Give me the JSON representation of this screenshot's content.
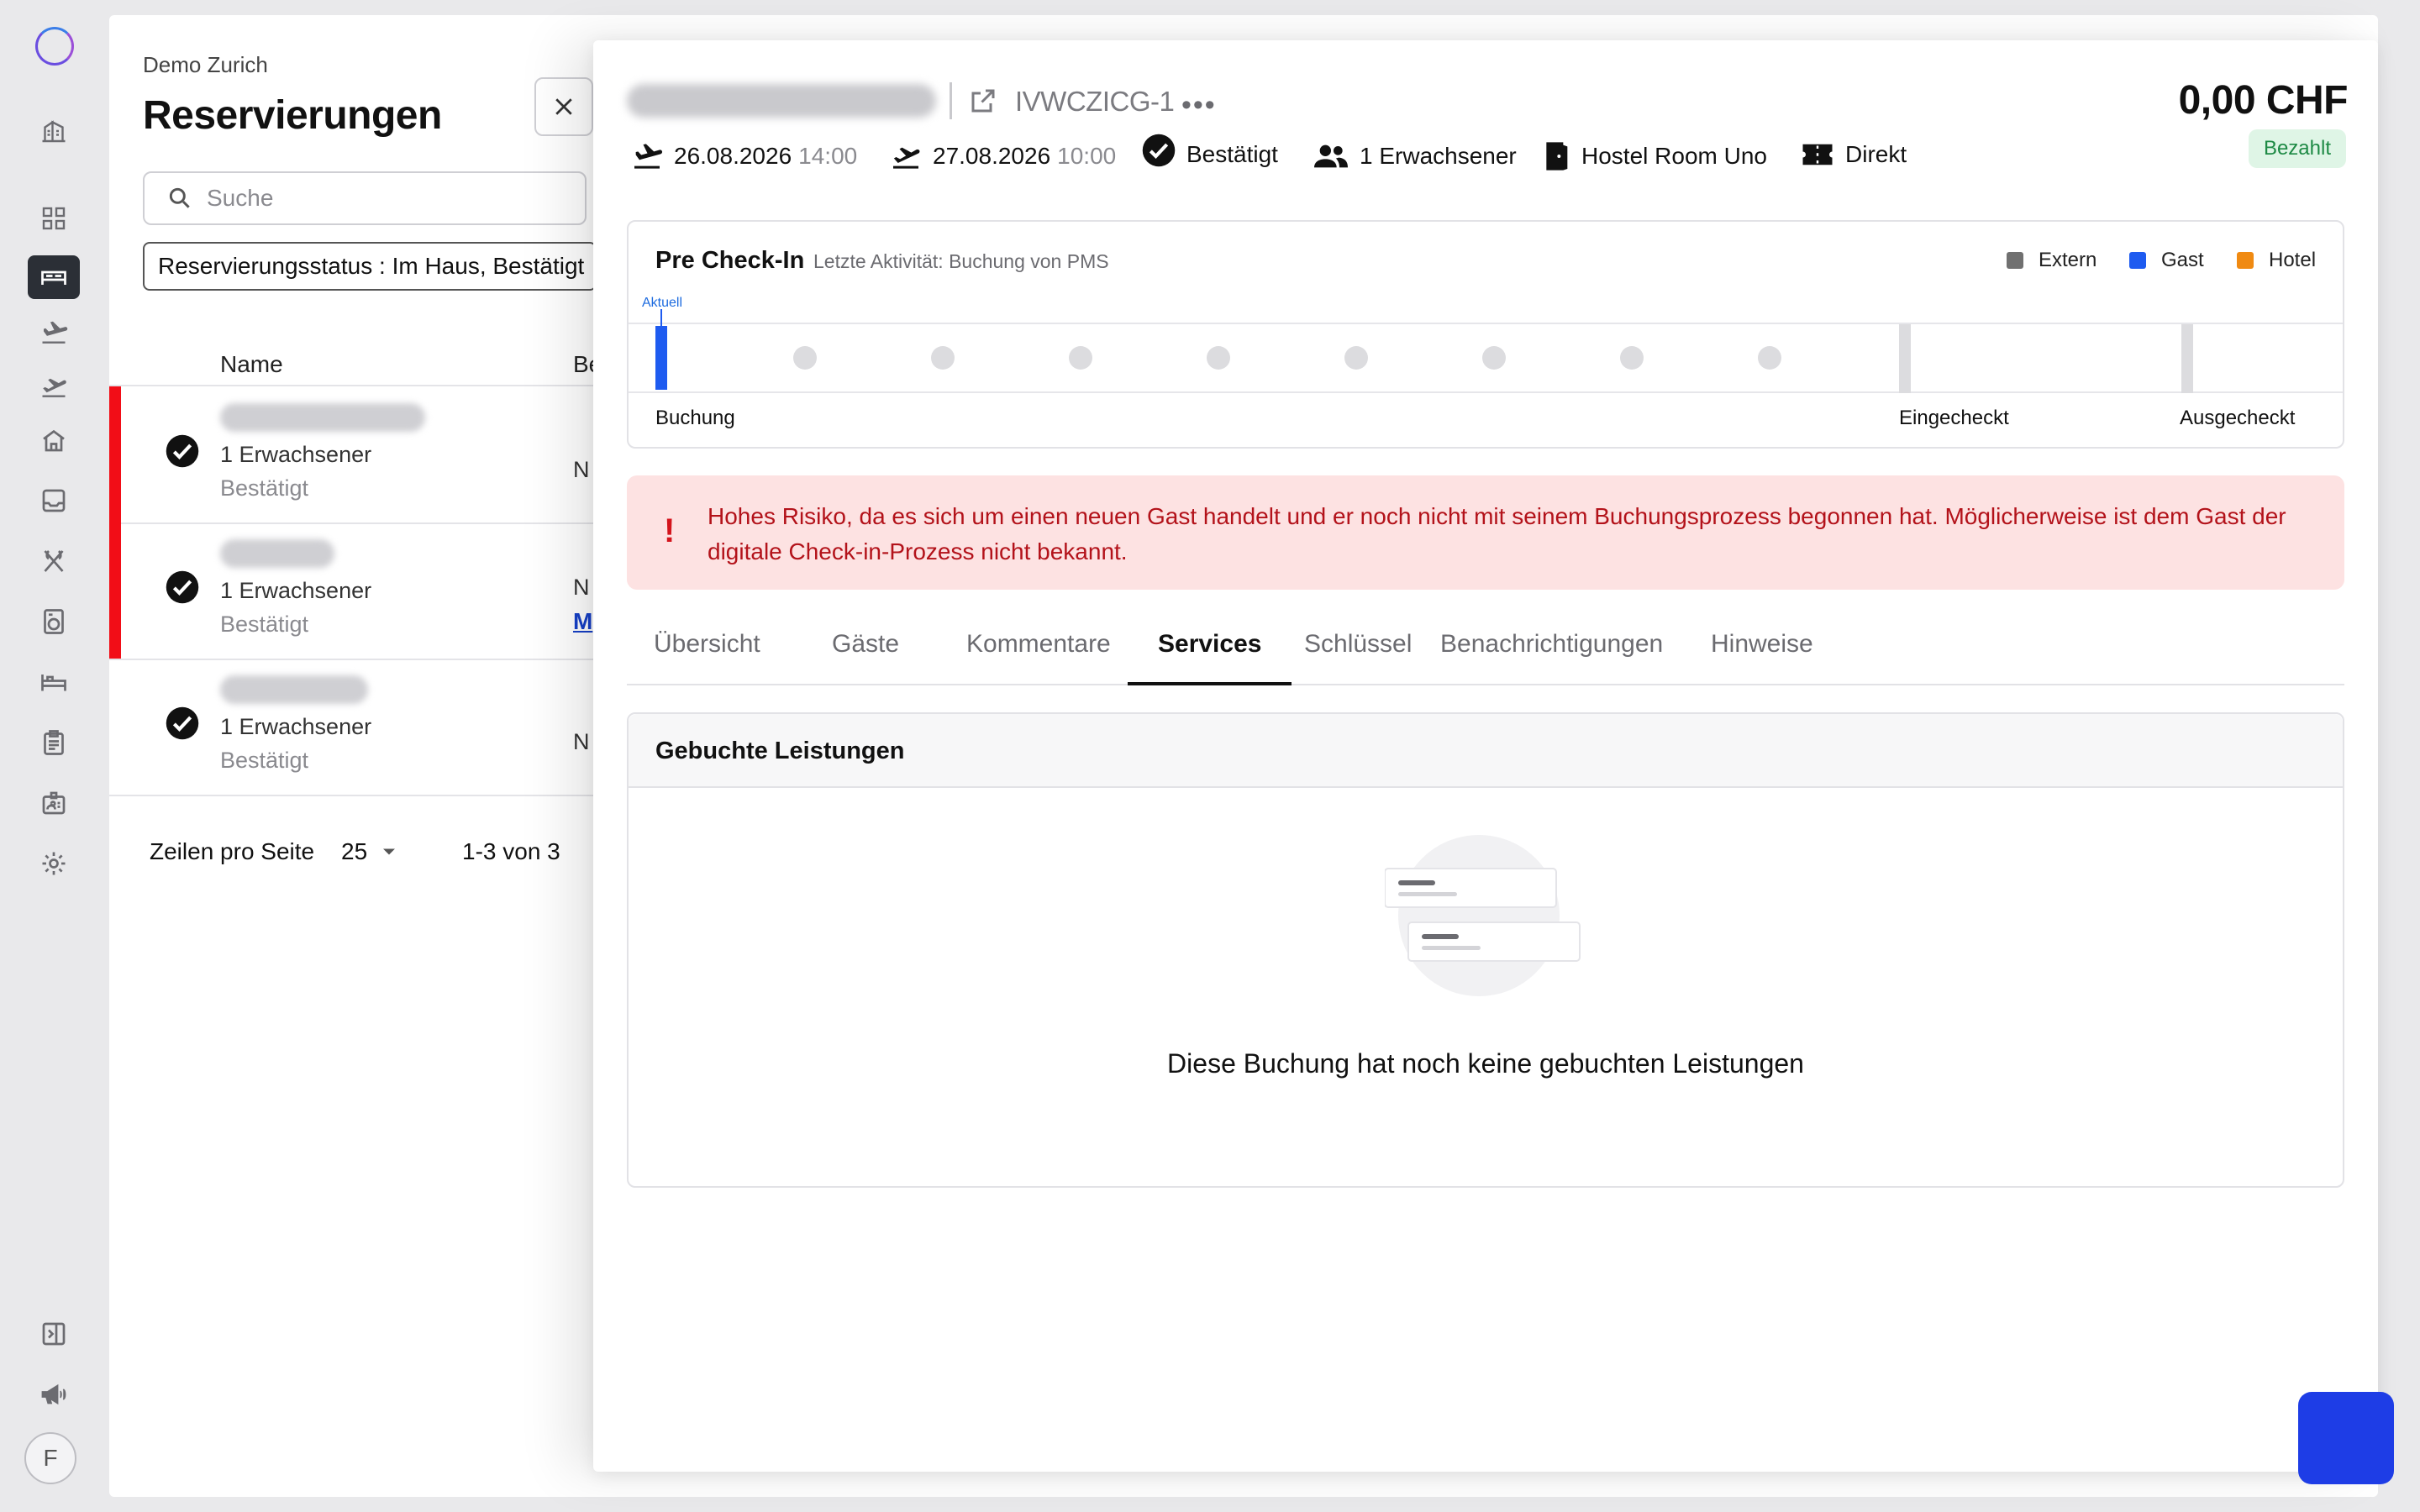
{
  "rail": {
    "items": [
      {
        "icon": "hotel-building-icon"
      },
      {
        "icon": "dashboard-grid-icon"
      },
      {
        "icon": "bed-reservations-icon",
        "active": true
      },
      {
        "icon": "arrival-plane-icon"
      },
      {
        "icon": "departure-plane-icon"
      },
      {
        "icon": "house-icon"
      },
      {
        "icon": "inbox-icon"
      },
      {
        "icon": "restaurant-icon"
      },
      {
        "icon": "washing-machine-icon"
      },
      {
        "icon": "room-bed-icon"
      },
      {
        "icon": "clipboard-icon"
      },
      {
        "icon": "id-badge-icon"
      },
      {
        "icon": "settings-gear-icon"
      }
    ],
    "bottom": [
      {
        "icon": "collapse-sidebar-icon"
      },
      {
        "icon": "megaphone-icon"
      }
    ],
    "avatar_initial": "F"
  },
  "list": {
    "org": "Demo Zurich",
    "title": "Reservierungen",
    "search_placeholder": "Suche",
    "filter": "Reservierungsstatus : Im Haus, Bestätigt",
    "columns": {
      "name": "Name",
      "second": "Be"
    },
    "rows": [
      {
        "guests": "1 Erwachsener",
        "status": "Bestätigt",
        "flagged": true,
        "col2": "N",
        "col2_link": ""
      },
      {
        "guests": "1 Erwachsener",
        "status": "Bestätigt",
        "flagged": true,
        "col2": "N",
        "col2_link": "M"
      },
      {
        "guests": "1 Erwachsener",
        "status": "Bestätigt",
        "flagged": false,
        "col2": "N",
        "col2_link": ""
      }
    ],
    "pager": {
      "rows_label": "Zeilen pro Seite",
      "rows_value": "25",
      "range": "1-3 von 3"
    }
  },
  "detail": {
    "code": "IVWCZICG-1",
    "more": "•••",
    "amount": "0,00 CHF",
    "payment_status": "Bezahlt",
    "arrival": {
      "date": "26.08.2026",
      "time": "14:00"
    },
    "departure": {
      "date": "27.08.2026",
      "time": "10:00"
    },
    "booking_status": "Bestätigt",
    "guests": "1 Erwachsener",
    "room": "Hostel Room Uno",
    "channel": "Direkt",
    "precheckin": {
      "title": "Pre Check-In",
      "activity": "Letzte Aktivität: Buchung von PMS",
      "legend": [
        {
          "label": "Extern",
          "color": "#707070"
        },
        {
          "label": "Gast",
          "color": "#1e5bf0"
        },
        {
          "label": "Hotel",
          "color": "#f08a12"
        }
      ],
      "current_label": "Aktuell",
      "steps": {
        "start": "Buchung",
        "checked_in": "Eingecheckt",
        "checked_out": "Ausgecheckt"
      }
    },
    "alert": "Hohes Risiko, da es sich um einen neuen Gast handelt und er noch nicht mit seinem Buchungsprozess begonnen hat. Möglicherweise ist dem Gast der digitale Check-in-Prozess nicht bekannt.",
    "tabs": [
      "Übersicht",
      "Gäste",
      "Kommentare",
      "Services",
      "Schlüssel",
      "Benachrichtigungen",
      "Hinweise"
    ],
    "active_tab": "Services",
    "services": {
      "title": "Gebuchte Leistungen",
      "empty": "Diese Buchung hat noch keine gebuchten Leistungen"
    }
  }
}
